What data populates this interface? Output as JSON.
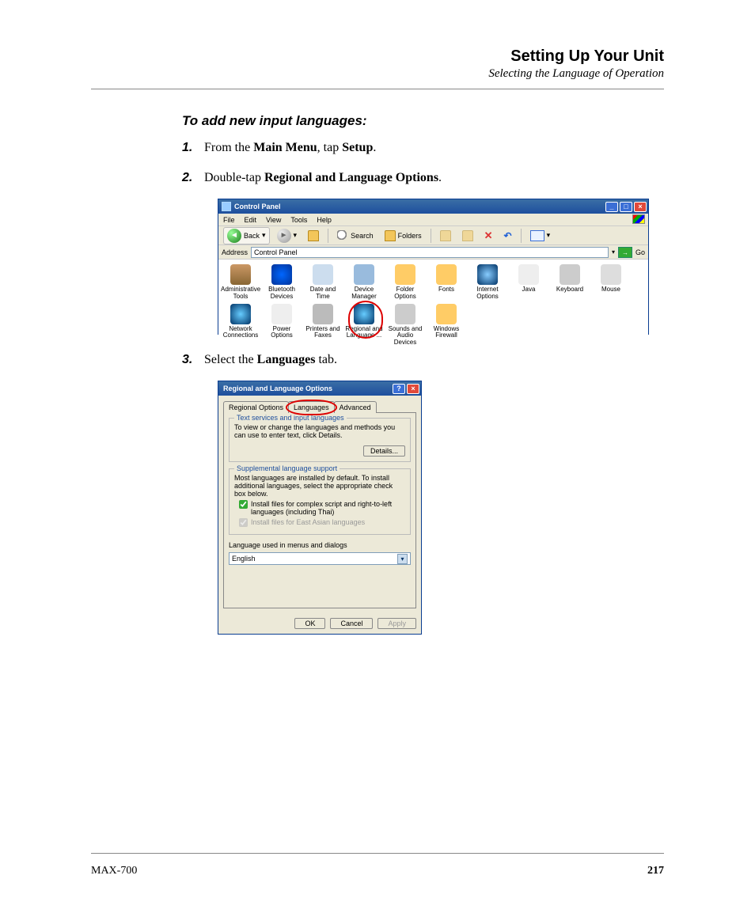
{
  "header": {
    "title": "Setting Up Your Unit",
    "subtitle": "Selecting the Language of Operation"
  },
  "task_heading": "To add new input languages:",
  "steps": {
    "s1": {
      "num": "1.",
      "pre": "From the ",
      "b1": "Main Menu",
      "mid": ", tap ",
      "b2": "Setup",
      "post": "."
    },
    "s2": {
      "num": "2.",
      "pre": "Double-tap ",
      "b1": "Regional and Language Options",
      "post": "."
    },
    "s3": {
      "num": "3.",
      "pre": "Select the ",
      "b1": "Languages",
      "post": " tab."
    }
  },
  "cp": {
    "title": "Control Panel",
    "menu": {
      "file": "File",
      "edit": "Edit",
      "view": "View",
      "tools": "Tools",
      "help": "Help"
    },
    "toolbar": {
      "back": "Back",
      "search": "Search",
      "folders": "Folders"
    },
    "address_label": "Address",
    "address_value": "Control Panel",
    "go": "Go",
    "icons": [
      {
        "cls": "admin",
        "label": "Administrative Tools"
      },
      {
        "cls": "bt",
        "label": "Bluetooth Devices"
      },
      {
        "cls": "dt",
        "label": "Date and Time"
      },
      {
        "cls": "dev",
        "label": "Device Manager"
      },
      {
        "cls": "fold",
        "label": "Folder Options"
      },
      {
        "cls": "font",
        "label": "Fonts"
      },
      {
        "cls": "ie",
        "label": "Internet Options"
      },
      {
        "cls": "java",
        "label": "Java"
      },
      {
        "cls": "kb",
        "label": "Keyboard"
      },
      {
        "cls": "mouse",
        "label": "Mouse"
      },
      {
        "cls": "net",
        "label": "Network Connections"
      },
      {
        "cls": "pwr",
        "label": "Power Options"
      },
      {
        "cls": "prn",
        "label": "Printers and Faxes"
      },
      {
        "cls": "reg",
        "label": "Regional and Language ...",
        "ring": true
      },
      {
        "cls": "snd",
        "label": "Sounds and Audio Devices"
      },
      {
        "cls": "fw",
        "label": "Windows Firewall"
      }
    ]
  },
  "rl": {
    "title": "Regional and Language Options",
    "tabs": {
      "regional": "Regional Options",
      "languages": "Languages",
      "advanced": "Advanced"
    },
    "group1": {
      "title": "Text services and input languages",
      "text": "To view or change the languages and methods you can use to enter text, click Details.",
      "details_btn": "Details..."
    },
    "group2": {
      "title": "Supplemental language support",
      "text": "Most languages are installed by default. To install additional languages, select the appropriate check box below.",
      "check1": "Install files for complex script and right-to-left languages (including Thai)",
      "check2": "Install files for East Asian languages"
    },
    "lang_used_label": "Language used in menus and dialogs",
    "lang_used_value": "English",
    "buttons": {
      "ok": "OK",
      "cancel": "Cancel",
      "apply": "Apply"
    }
  },
  "footer": {
    "product": "MAX-700",
    "page": "217"
  }
}
